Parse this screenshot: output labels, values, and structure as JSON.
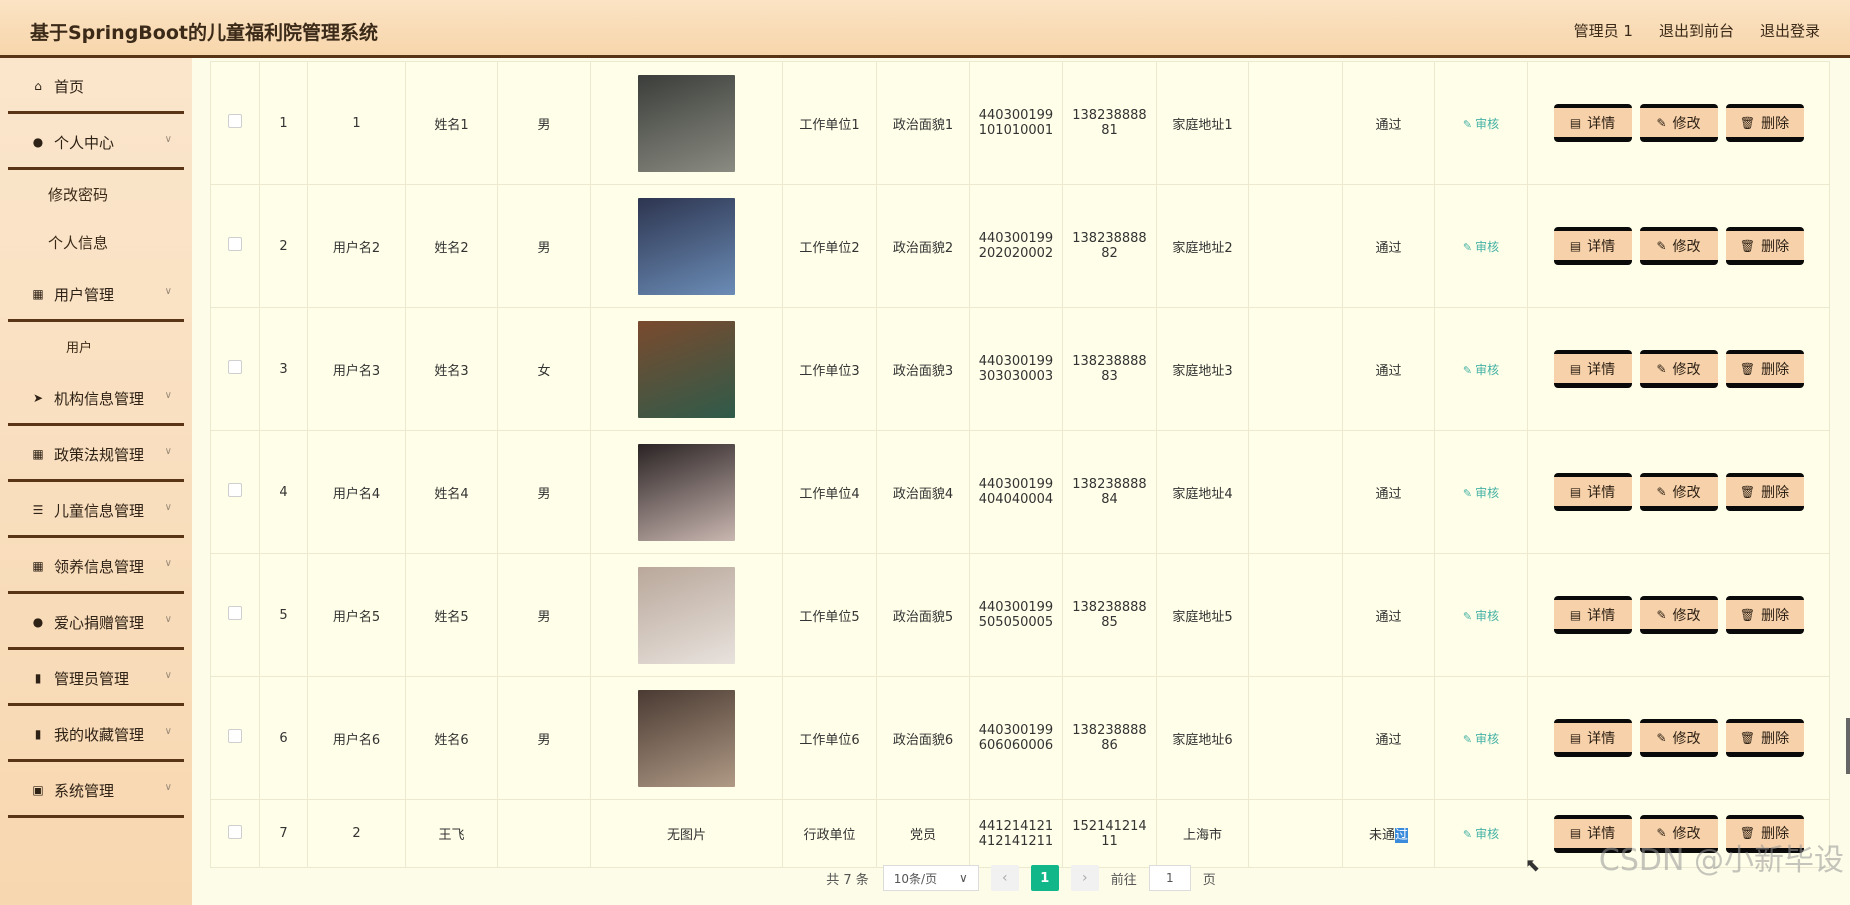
{
  "app": {
    "title": "基于SpringBoot的儿童福利院管理系统"
  },
  "header": {
    "links": [
      "管理员 1",
      "退出到前台",
      "退出登录"
    ]
  },
  "sidebar": {
    "items": [
      {
        "label": "首页",
        "icon": "home-icon",
        "glyph": "⌂"
      },
      {
        "label": "个人中心",
        "icon": "user-icon",
        "glyph": "●"
      },
      {
        "label": "修改密码"
      },
      {
        "label": "个人信息"
      },
      {
        "label": "用户管理",
        "icon": "grid-icon",
        "glyph": "▦"
      },
      {
        "label": "用户"
      },
      {
        "label": "机构信息管理",
        "icon": "send-icon",
        "glyph": "➤"
      },
      {
        "label": "政策法规管理",
        "icon": "grid-icon",
        "glyph": "▦"
      },
      {
        "label": "儿童信息管理",
        "icon": "list-icon",
        "glyph": "☰"
      },
      {
        "label": "领养信息管理",
        "icon": "grid-icon",
        "glyph": "▦"
      },
      {
        "label": "爱心捐赠管理",
        "icon": "user-icon",
        "glyph": "●"
      },
      {
        "label": "管理员管理",
        "icon": "bars-icon",
        "glyph": "▮"
      },
      {
        "label": "我的收藏管理",
        "icon": "chart-icon",
        "glyph": "▮"
      },
      {
        "label": "系统管理",
        "icon": "clipboard-icon",
        "glyph": "▣"
      }
    ]
  },
  "table": {
    "rows": [
      {
        "index": "1",
        "username": "1",
        "name": "姓名1",
        "gender": "男",
        "photo": "photo-1",
        "photo_colors": [
          "#3b3d3a",
          "#8a8c82"
        ],
        "work": "工作单位1",
        "political": "政治面貌1",
        "id1": "440300199",
        "id2": "101010001",
        "phone1": "138238888",
        "phone2": "81",
        "address": "家庭地址1",
        "status": "通过"
      },
      {
        "index": "2",
        "username": "用户名2",
        "name": "姓名2",
        "gender": "男",
        "photo": "photo-2",
        "photo_colors": [
          "#2d3550",
          "#6b8cb6"
        ],
        "work": "工作单位2",
        "political": "政治面貌2",
        "id1": "440300199",
        "id2": "202020002",
        "phone1": "138238888",
        "phone2": "82",
        "address": "家庭地址2",
        "status": "通过"
      },
      {
        "index": "3",
        "username": "用户名3",
        "name": "姓名3",
        "gender": "女",
        "photo": "photo-3",
        "photo_colors": [
          "#7a4a2e",
          "#2f5b4a"
        ],
        "work": "工作单位3",
        "political": "政治面貌3",
        "id1": "440300199",
        "id2": "303030003",
        "phone1": "138238888",
        "phone2": "83",
        "address": "家庭地址3",
        "status": "通过"
      },
      {
        "index": "4",
        "username": "用户名4",
        "name": "姓名4",
        "gender": "男",
        "photo": "photo-4",
        "photo_colors": [
          "#2a2324",
          "#c9b6b0"
        ],
        "work": "工作单位4",
        "political": "政治面貌4",
        "id1": "440300199",
        "id2": "404040004",
        "phone1": "138238888",
        "phone2": "84",
        "address": "家庭地址4",
        "status": "通过"
      },
      {
        "index": "5",
        "username": "用户名5",
        "name": "姓名5",
        "gender": "男",
        "photo": "photo-5",
        "photo_colors": [
          "#b9a79a",
          "#e8e2dd"
        ],
        "work": "工作单位5",
        "political": "政治面貌5",
        "id1": "440300199",
        "id2": "505050005",
        "phone1": "138238888",
        "phone2": "85",
        "address": "家庭地址5",
        "status": "通过"
      },
      {
        "index": "6",
        "username": "用户名6",
        "name": "姓名6",
        "gender": "男",
        "photo": "photo-6",
        "photo_colors": [
          "#4a3a32",
          "#b09a86"
        ],
        "work": "工作单位6",
        "political": "政治面貌6",
        "id1": "440300199",
        "id2": "606060006",
        "phone1": "138238888",
        "phone2": "86",
        "address": "家庭地址6",
        "status": "通过"
      },
      {
        "index": "7",
        "username": "2",
        "name": "王飞",
        "gender": "",
        "photo": "",
        "no_photo": "无图片",
        "work": "行政单位",
        "political": "党员",
        "id1": "441214121",
        "id2": "412141211",
        "phone1": "152141214",
        "phone2": "11",
        "address": "上海市",
        "status_a": "未通",
        "status_b": "过"
      }
    ],
    "actions": {
      "audit": "审核",
      "details": "详情",
      "edit": "修改",
      "delete": "删除"
    }
  },
  "pagination": {
    "total": "共 7 条",
    "page_size": "10条/页",
    "current": "1",
    "goto_label": "前往",
    "goto_value": "1",
    "page_suffix": "页"
  },
  "watermark": "CSDN @小新毕设"
}
